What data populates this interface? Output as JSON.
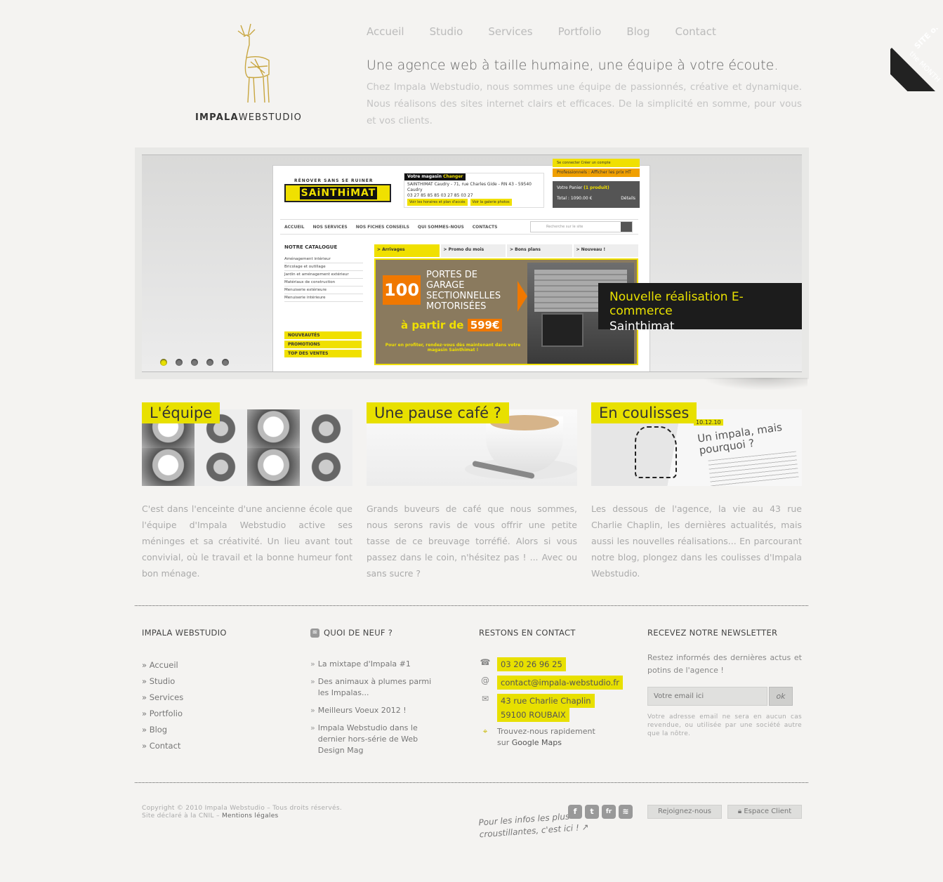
{
  "header": {
    "logo": {
      "brand_bold": "IMPALA",
      "brand_light": "WEBSTUDIO"
    },
    "nav": [
      {
        "label": "Accueil",
        "active": true
      },
      {
        "label": "Studio",
        "active": false
      },
      {
        "label": "Services",
        "active": false
      },
      {
        "label": "Portfolio",
        "active": false
      },
      {
        "label": "Blog",
        "active": false
      },
      {
        "label": "Contact",
        "active": false
      }
    ],
    "intro_title": "Une agence web à taille humaine, une équipe à votre écoute.",
    "intro_text": "Chez Impala Webstudio, nous sommes une équipe de passionnés, créative et dynamique. Nous réalisons des sites internet clairs et efficaces. De la simplicité en somme, pour vous et vos clients."
  },
  "ribbon": {
    "line1": "SITE of",
    "line2": "the MONTH"
  },
  "slider": {
    "caption_title": "Nouvelle réalisation E-commerce",
    "caption_subtitle": "Sainthimat",
    "active_slide": 1,
    "slide_count": 5,
    "screenshot": {
      "tagline": "RÉNOVER SANS SE RUINER",
      "logo": "SAiNTHiMAT",
      "store_tag": "Votre magasin",
      "store_change": "Changer",
      "store_address": "SAINTHIMAT Caudry - 71, rue Charles Gide - RN 43 - 59540 Caudry",
      "store_phones": "03 27 85 85 85   03 27 85 03 27",
      "store_links": [
        "Voir les horaires et plan d'accès",
        "Voir la galerie photos"
      ],
      "account": "Se connecter     Créer un compte",
      "pro": "Professionnels : Afficher les prix HT",
      "cart_title": "Votre Panier",
      "cart_count": "(1 produit)",
      "cart_total": "Total : 1090.00 €",
      "cart_details": "Détails",
      "menu": [
        "ACCUEIL",
        "NOS SERVICES",
        "NOS FICHES CONSEILS",
        "QUI SOMMES-NOUS",
        "CONTACTS"
      ],
      "search_placeholder": "Recherche sur le site",
      "catalog_title": "NOTRE CATALOGUE",
      "catalog": [
        "Aménagement intérieur",
        "Bricolage et outillage",
        "Jardin et aménagement extérieur",
        "Matériaux de construction",
        "Menuiserie extérieure",
        "Menuiserie intérieure"
      ],
      "catalog_yellow": [
        "NOUVEAUTÉS",
        "PROMOTIONS",
        "TOP DES VENTES"
      ],
      "tabs": [
        "> Arrivages",
        "> Promo du mois",
        "> Bons plans",
        "> Nouveau !"
      ],
      "banner_number": "100",
      "banner_text": "PORTES DE GARAGE SECTIONNELLES MOTORISÉES",
      "banner_price_prefix": "à partir de",
      "banner_price": "599€",
      "banner_note": "Pour en profiter, rendez-vous dès maintenant dans votre magasin Sainthimat !"
    }
  },
  "columns": [
    {
      "title": "L'équipe",
      "text": "C'est dans l'enceinte d'une ancienne école que l'équipe d'Impala Webstudio active ses méninges et sa créativité. Un lieu avant tout convivial, où le travail et la bonne humeur font bon ménage."
    },
    {
      "title": "Une pause café ?",
      "text": "Grands buveurs de café que nous sommes, nous serons ravis de vous offrir une petite tasse de ce breuvage torréfié. Alors si vous passez dans le coin, n'hésitez pas ! ... Avec ou sans sucre ?"
    },
    {
      "title": "En coulisses",
      "text": "Les dessous de l'agence, la vie au 43 rue Charlie Chaplin, les dernières actualités, mais aussi les nouvelles réalisations... En parcourant notre blog, plongez dans les coulisses d'Impala Webstudio.",
      "image_date": "10.12.10",
      "image_title": "Un impala, mais pourquoi ?"
    }
  ],
  "footer": {
    "col1": {
      "title": "IMPALA WEBSTUDIO",
      "links": [
        "» Accueil",
        "» Studio",
        "» Services",
        "» Portfolio",
        "» Blog",
        "» Contact"
      ]
    },
    "col2": {
      "title": "QUOI DE NEUF ?",
      "items": [
        "La mixtape d'Impala #1",
        "Des animaux à plumes parmi les Impalas...",
        "Meilleurs Voeux 2012 !",
        "Impala Webstudio dans le dernier hors-série de Web Design Mag"
      ]
    },
    "col3": {
      "title": "RESTONS EN CONTACT",
      "phone": "03 20 26 96 25",
      "email": "contact@impala-webstudio.fr",
      "address_line1": "43 rue Charlie Chaplin",
      "address_line2": "59100 ROUBAIX",
      "maps_text": "Trouvez-nous rapidement",
      "maps_prefix": "sur",
      "maps_link": "Google Maps"
    },
    "col4": {
      "title": "RECEVEZ NOTRE NEWSLETTER",
      "text": "Restez informés des dernières actus et potins de l'agence !",
      "input_placeholder": "Votre email ici",
      "button": "ok",
      "note": "Votre adresse email ne sera en aucun cas revendue, ou utilisée par une société autre que la nôtre."
    },
    "copyright_line1": "Copyright © 2010 Impala Webstudio – Tous droits réservés.",
    "copyright_line2": "Site déclaré à la CNIL –",
    "legal_link": "Mentions légales",
    "social_tagline_1": "Pour les infos les plus",
    "social_tagline_2": "croustillantes, c'est ici !",
    "social_icons": [
      {
        "name": "facebook",
        "glyph": "f"
      },
      {
        "name": "twitter",
        "glyph": "t"
      },
      {
        "name": "friendfeed",
        "glyph": "fr"
      },
      {
        "name": "rss",
        "glyph": "≋"
      }
    ],
    "join_button": "Rejoignez-nous",
    "client_button": "Espace Client"
  },
  "colors": {
    "accent": "#e8e000",
    "background": "#f4f3f1",
    "caption_bg": "#1c1c1c"
  }
}
